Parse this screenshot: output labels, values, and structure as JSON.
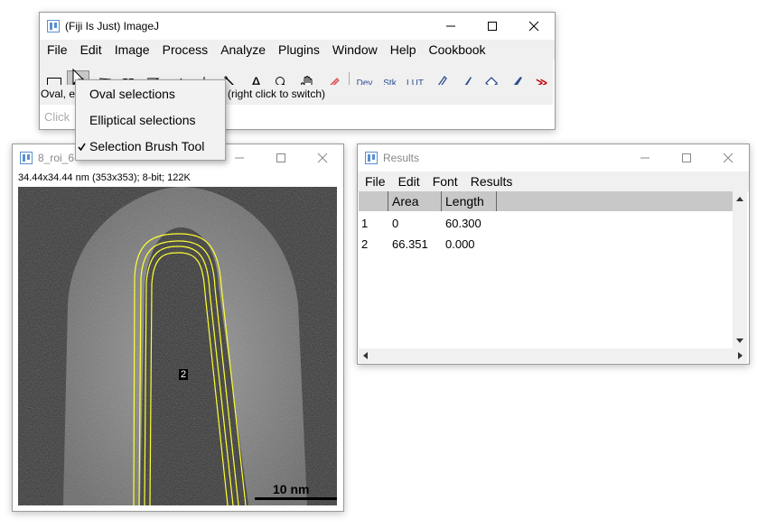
{
  "imagej": {
    "title": "(Fiji Is Just) ImageJ",
    "menu": [
      "File",
      "Edit",
      "Image",
      "Process",
      "Analyze",
      "Plugins",
      "Window",
      "Help",
      "Cookbook"
    ],
    "tools": {
      "dev": "Dev",
      "stk": "Stk",
      "lut": "LUT",
      "text_tool": "A",
      "more": "≫"
    },
    "status_prefix": "Oval, e",
    "status_suffix": "(right click to switch)",
    "hint": "Click"
  },
  "dropdown": {
    "items": [
      {
        "label": "Oval selections",
        "checked": false
      },
      {
        "label": "Elliptical selections",
        "checked": false
      },
      {
        "label": "Selection Brush Tool",
        "checked": true
      }
    ]
  },
  "image_window": {
    "title": "8_roi_6",
    "info": "34.44x34.44 nm (353x353); 8-bit; 122K",
    "roi_label": "2",
    "scale_bar": "10 nm"
  },
  "results": {
    "title": "Results",
    "menu": [
      "File",
      "Edit",
      "Font",
      "Results"
    ],
    "columns": [
      "",
      "Area",
      "Length"
    ],
    "rows": [
      [
        "1",
        "0",
        "60.300"
      ],
      [
        "2",
        "66.351",
        "0.000"
      ]
    ]
  },
  "colors": {
    "roi": "#ffff33",
    "accent": "#c00000",
    "icon_blue": "#2a4d8f"
  }
}
